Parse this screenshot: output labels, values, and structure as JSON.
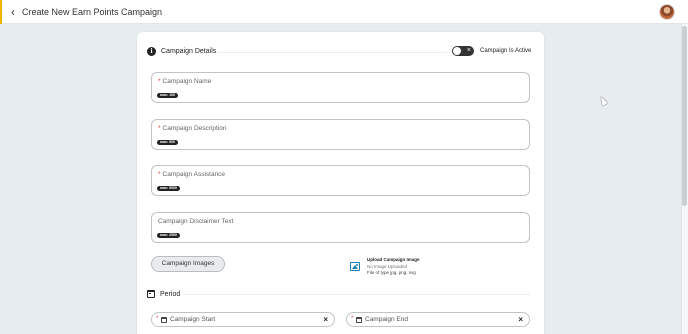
{
  "header": {
    "back_icon": "chevron-left-icon",
    "title": "Create New Earn Points Campaign",
    "avatar_icon": "user-avatar"
  },
  "details": {
    "title": "Campaign Details",
    "icon": "info-icon",
    "active_label": "Campaign Is Active",
    "active": false,
    "fields": [
      {
        "label": "Campaign Name",
        "required": "*",
        "max": "max: 100"
      },
      {
        "label": "Campaign Description",
        "required": "*",
        "max": "max: 500"
      },
      {
        "label": "Campaign Assistance",
        "required": "*",
        "max": "max: 5000"
      },
      {
        "label": "Campaign Disclaimer Text",
        "required": "",
        "max": "max: 2500"
      }
    ],
    "images_button": "Campaign Images",
    "upload": {
      "title": "Upload Campaign Image",
      "status": "No Image Uploaded",
      "types": "File of type jpg, png, svg"
    }
  },
  "period": {
    "title": "Period",
    "start_label": "Campaign Start",
    "end_label": "Campaign End",
    "required": "*",
    "clear": "×"
  },
  "colors": {
    "accent": "#f0b400",
    "required": "#e53935",
    "upload_icon": "#1a7fb5"
  }
}
